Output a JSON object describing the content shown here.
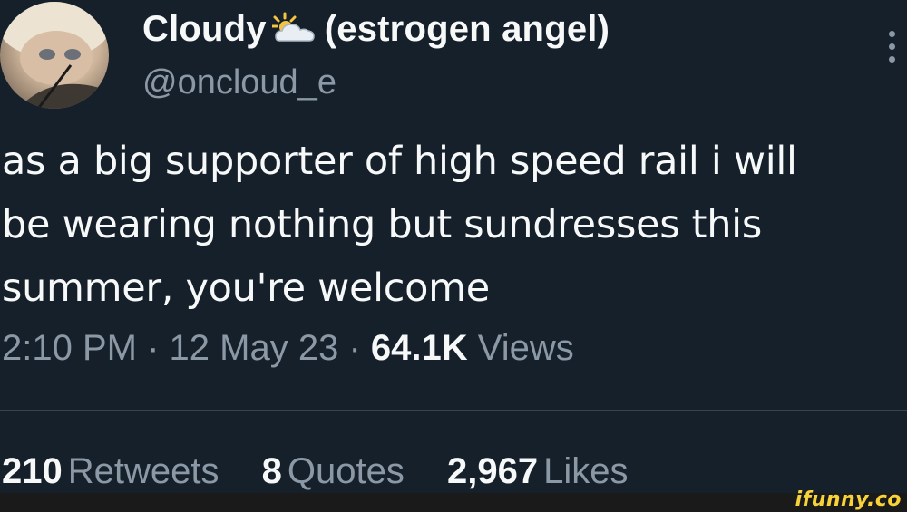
{
  "tweet": {
    "author": {
      "display_name": "Cloudy",
      "display_name_suffix": "(estrogen angel)",
      "name_icon": "sun-behind-cloud-icon",
      "handle": "@oncloud_e"
    },
    "text_lines": [
      "as a big supporter of high speed rail i will",
      "be wearing nothing but sundresses this",
      "summer, you're welcome"
    ],
    "time": "2:10 PM",
    "separator": "·",
    "date": "12 May 23",
    "views_count": "64.1K",
    "views_label": "Views",
    "stats": {
      "retweets_count": "210",
      "retweets_label": "Retweets",
      "quotes_count": "8",
      "quotes_label": "Quotes",
      "likes_count": "2,967",
      "likes_label": "Likes"
    }
  },
  "watermark": "ifunny.co",
  "colors": {
    "background": "#15202b",
    "text": "#f7f9f9",
    "secondary_text": "#8b98a5",
    "divider": "#38444d",
    "watermark": "#f7d23a"
  }
}
